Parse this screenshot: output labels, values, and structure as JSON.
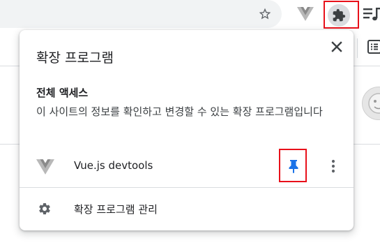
{
  "toolbar": {
    "bookmark_icon": "star-outline-icon",
    "vue_extension_icon": "vue-logo-icon",
    "extensions_icon": "puzzle-piece-icon",
    "media_icon": "queue-music-icon"
  },
  "popup": {
    "title": "확장 프로그램",
    "close_icon": "close-icon",
    "section": {
      "heading": "전체 액세스",
      "description": "이 사이트의 정보를 확인하고 변경할 수 있는 확장 프로그램입니다"
    },
    "extensions": [
      {
        "name": "Vue.js devtools",
        "icon": "vue-logo-icon",
        "pinned": true,
        "pin_icon": "pin-icon",
        "menu_icon": "more-vert-icon"
      }
    ],
    "manage": {
      "label": "확장 프로그램 관리",
      "icon": "gear-icon"
    }
  },
  "colors": {
    "highlight_red": "#e8101a",
    "pin_blue": "#1a73e8",
    "icon_gray": "#5f6368",
    "omnibox_bg": "#f1f3f4",
    "active_button_bg": "#dadce0"
  }
}
